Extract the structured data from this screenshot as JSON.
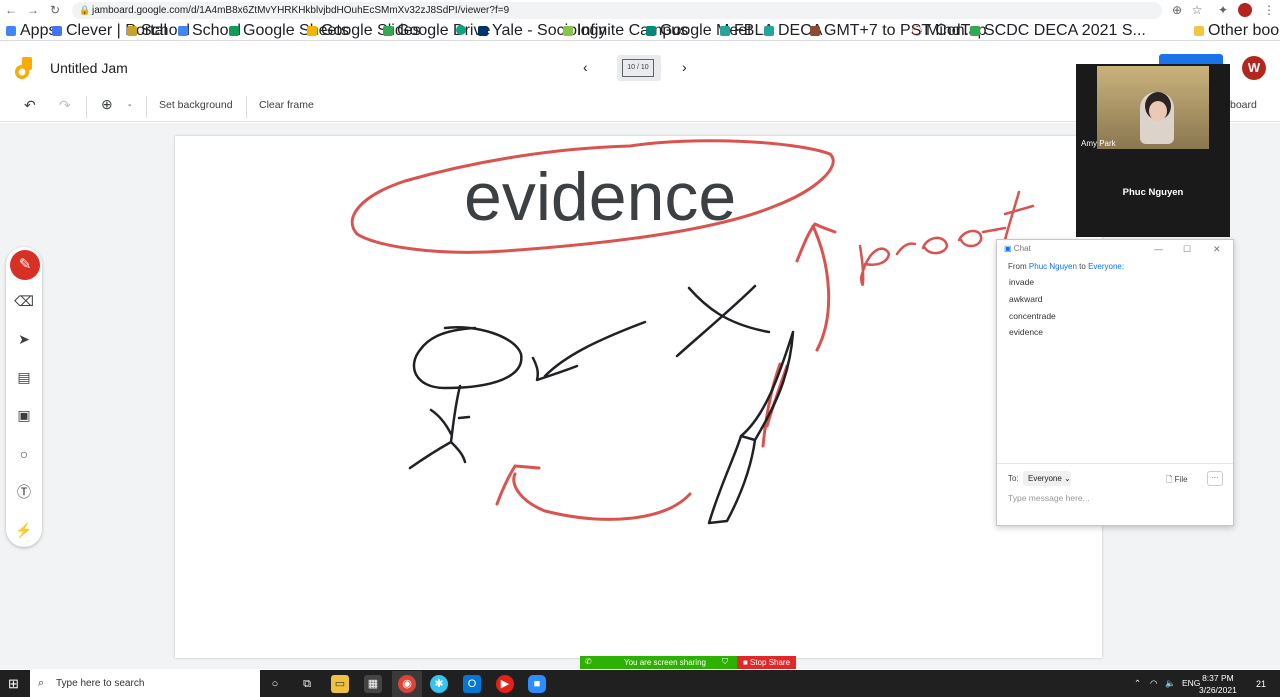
{
  "browser": {
    "url": "jamboard.google.com/d/1A4mB8x6ZtMvYHRKHkblvjbdHOuhEcSMmXv32zJ8SdPI/viewer?f=9"
  },
  "bookmarks": [
    {
      "label": "Apps",
      "color": "#4285f4"
    },
    {
      "label": "Clever | Portal",
      "color": "#4274f6"
    },
    {
      "label": "School",
      "color": "#c9a227"
    },
    {
      "label": "School",
      "color": "#4285f4"
    },
    {
      "label": "Google Sheets",
      "color": "#0f9d58"
    },
    {
      "label": "Google Slides",
      "color": "#f4b400"
    },
    {
      "label": "Google Drive",
      "color": "#34a853"
    },
    {
      "label": "",
      "color": "#10a37f"
    },
    {
      "label": "Yale - Sociology",
      "color": "#00356b"
    },
    {
      "label": "Infinite Campus",
      "color": "#8bc34a"
    },
    {
      "label": "Google Meet",
      "color": "#00897b"
    },
    {
      "label": "FBLA",
      "color": "#26a69a"
    },
    {
      "label": "DECA",
      "color": "#26a69a"
    },
    {
      "label": "GMT+7 to PST Con...",
      "color": "#8d4a2f"
    },
    {
      "label": "MindTap",
      "color": "#d32f2f"
    },
    {
      "label": "SCDC DECA 2021 S...",
      "color": "#34a853"
    }
  ],
  "other_bookmarks": "Other bookmarks",
  "jam": {
    "title": "Untitled Jam",
    "pager": "10 / 10"
  },
  "toolbar": {
    "set_background": "Set background",
    "clear_frame": "Clear frame",
    "zoom_caret": "-",
    "share_tail": "board"
  },
  "canvas": {
    "word": "evidence"
  },
  "video": {
    "caption": "Amy Park",
    "name": "Phuc Nguyen"
  },
  "chat": {
    "title": "Chat",
    "from": "From",
    "sender": "Phuc Nguyen",
    "to_word": "to",
    "recipient": "Everyone:",
    "messages": [
      "invade",
      "awkward",
      "concentrade",
      "evidence"
    ],
    "to_label": "To:",
    "to_value": "Everyone",
    "file": "File",
    "more": "···",
    "placeholder": "Type message here..."
  },
  "share": {
    "status": "You are screen sharing",
    "stop": "Stop Share"
  },
  "taskbar": {
    "search": "Type here to search",
    "time": "8:37 PM",
    "date": "3/26/2021",
    "lang": "ENG",
    "notif": "21"
  }
}
